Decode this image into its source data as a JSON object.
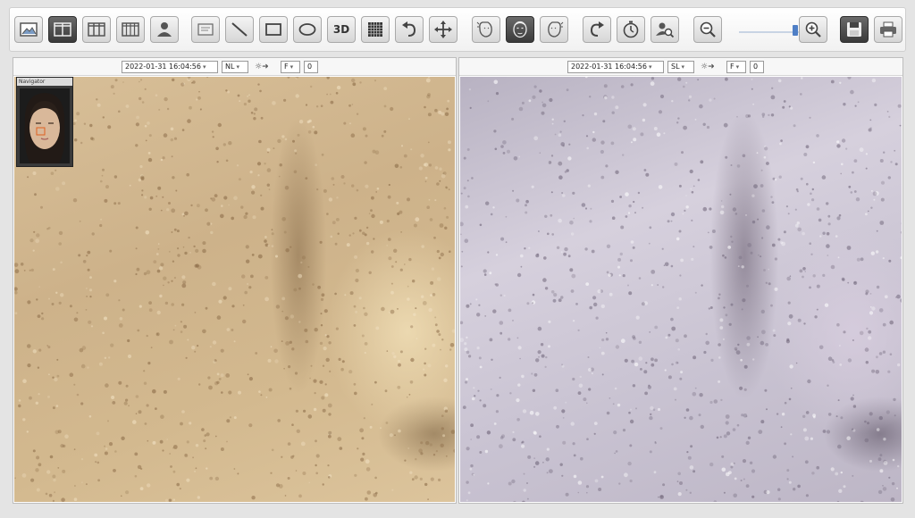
{
  "toolbar": {
    "buttons": [
      {
        "id": "image",
        "icon": "image-icon",
        "active": false
      },
      {
        "id": "layout-2",
        "icon": "layout-two-icon",
        "active": true
      },
      {
        "id": "layout-3",
        "icon": "layout-three-icon",
        "active": false
      },
      {
        "id": "layout-4",
        "icon": "layout-four-icon",
        "active": false
      },
      {
        "id": "user",
        "icon": "user-icon",
        "active": false
      },
      {
        "id": "text-box",
        "icon": "textbox-icon",
        "active": false
      },
      {
        "id": "line",
        "icon": "line-icon",
        "active": false
      },
      {
        "id": "rectangle",
        "icon": "rectangle-icon",
        "active": false
      },
      {
        "id": "ellipse",
        "icon": "ellipse-icon",
        "active": false
      },
      {
        "id": "3d",
        "icon": "3d-icon",
        "label": "3D",
        "active": false
      },
      {
        "id": "grid",
        "icon": "grid-icon",
        "active": false
      },
      {
        "id": "undo",
        "icon": "undo-icon",
        "active": false
      },
      {
        "id": "move",
        "icon": "move-icon",
        "active": false
      },
      {
        "id": "face-left",
        "icon": "face-left-icon",
        "active": false
      },
      {
        "id": "face-front",
        "icon": "face-front-icon",
        "active": true
      },
      {
        "id": "face-right",
        "icon": "face-right-icon",
        "active": false
      },
      {
        "id": "redo",
        "icon": "redo-icon",
        "active": false
      },
      {
        "id": "timer",
        "icon": "timer-icon",
        "active": false
      },
      {
        "id": "user-search",
        "icon": "user-search-icon",
        "active": false
      },
      {
        "id": "zoom-out",
        "icon": "zoom-out-icon",
        "active": false
      },
      {
        "id": "zoom-in",
        "icon": "zoom-in-icon",
        "active": false
      },
      {
        "id": "save",
        "icon": "save-icon",
        "active": true
      },
      {
        "id": "print",
        "icon": "print-icon",
        "active": false
      }
    ],
    "zoom_fraction": 0.9
  },
  "left_pane": {
    "datetime": "2022-01-31 16:04:56",
    "light_mode": "NL",
    "light_symbol": "☼➜",
    "view": "F",
    "counter": "0"
  },
  "right_pane": {
    "datetime": "2022-01-31 16:04:56",
    "light_mode": "SL",
    "light_symbol": "☼➜",
    "view": "F",
    "counter": "0"
  },
  "navigator": {
    "title": "Navigator"
  },
  "colors": {
    "active_button": "#4a4a4a",
    "slider_thumb": "#4f7fc6",
    "navigator_marker": "#e06020"
  }
}
